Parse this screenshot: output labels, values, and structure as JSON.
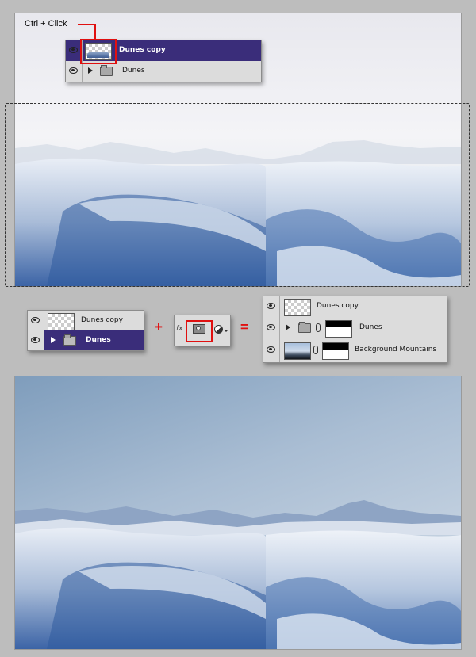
{
  "callout": {
    "text": "Ctrl + Click"
  },
  "panel_top": {
    "rows": [
      {
        "label": "Dunes copy",
        "selected": true
      },
      {
        "label": "Dunes",
        "selected": false
      }
    ]
  },
  "panel_left": {
    "rows": [
      {
        "label": "Dunes copy",
        "selected": false
      },
      {
        "label": "Dunes",
        "selected": true
      }
    ]
  },
  "buttons": {
    "fx": "fx"
  },
  "operators": {
    "plus": "+",
    "equals": "="
  },
  "panel_result": {
    "rows": [
      {
        "label": "Dunes copy"
      },
      {
        "label": "Dunes"
      },
      {
        "label": "Background Mountains"
      }
    ]
  },
  "colors": {
    "selected_row": "#3a2d7a",
    "highlight": "#e01010"
  },
  "icons": [
    "eye-icon",
    "folder-icon",
    "link-icon",
    "layer-mask-icon",
    "adjustment-icon",
    "expand-triangle-icon"
  ]
}
